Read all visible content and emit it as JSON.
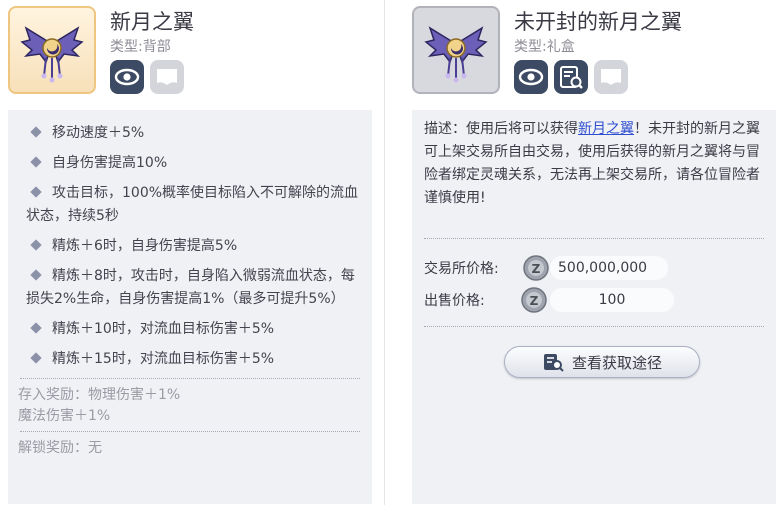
{
  "left": {
    "name": "新月之翼",
    "type_label": "类型:",
    "type_value": "背部",
    "stats": [
      "移动速度＋5%",
      "自身伤害提高10%",
      "攻击目标，100%概率使目标陷入不可解除的流血状态，持续5秒",
      "精炼＋6时，自身伤害提高5%",
      "精炼＋8时，攻击时，自身陷入微弱流血状态，每损失2%生命，自身伤害提高1%（最多可提升5%）",
      "精炼＋10时，对流血目标伤害＋5%",
      "精炼＋15时，对流血目标伤害＋5%"
    ],
    "deposit_reward_line1": "存入奖励：物理伤害＋1%",
    "deposit_reward_line2": "魔法伤害＋1%",
    "unlock_reward": "解锁奖励：无"
  },
  "right": {
    "name": "未开封的新月之翼",
    "type_label": "类型:",
    "type_value": "礼盒",
    "desc_prefix": "描述：使用后将可以获得",
    "desc_link": "新月之翼",
    "desc_suffix": "！未开封的新月之翼可上架交易所自由交易，使用后获得的新月之翼将与冒险者绑定灵魂关系，无法再上架交易所，请各位冒险者谨慎使用!",
    "exchange_price_label": "交易所价格:",
    "exchange_price": "500,000,000",
    "sell_price_label": "出售价格:",
    "sell_price": "100",
    "source_button": "查看获取途径"
  },
  "colors": {
    "accent": "#3d4a63",
    "link": "#2f4fd0",
    "panel_bg": "#eff1f5"
  },
  "icons": [
    "wings-icon",
    "eye-icon",
    "card-icon",
    "inspect-icon",
    "coin-icon"
  ]
}
